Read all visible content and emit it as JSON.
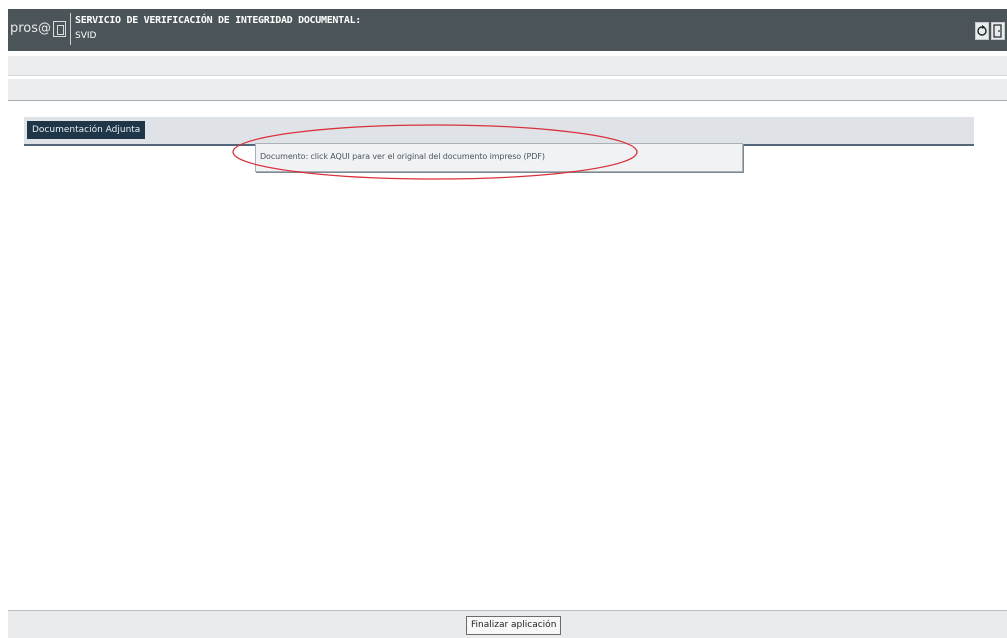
{
  "header": {
    "logo_text": "pros@",
    "title": "SERVICIO DE VERIFICACIÓN DE INTEGRIDAD DOCUMENTAL:",
    "subtitle": "SVID",
    "icons": [
      "refresh-icon",
      "exit-door-icon"
    ]
  },
  "tabs": [
    {
      "label": "Documentación Adjunta",
      "active": true
    }
  ],
  "dropdown": {
    "items": [
      {
        "label": "Documento: click AQUI para ver el original del documento impreso (PDF)"
      }
    ]
  },
  "annotation": {
    "color": "#d9303b",
    "shape": "ellipse"
  },
  "footer": {
    "finish_label": "Finalizar aplicación"
  },
  "colors": {
    "header_bg": "#4b5559",
    "tab_active_bg": "#1f3649",
    "tab_strip_bg": "#dfe3e7"
  }
}
